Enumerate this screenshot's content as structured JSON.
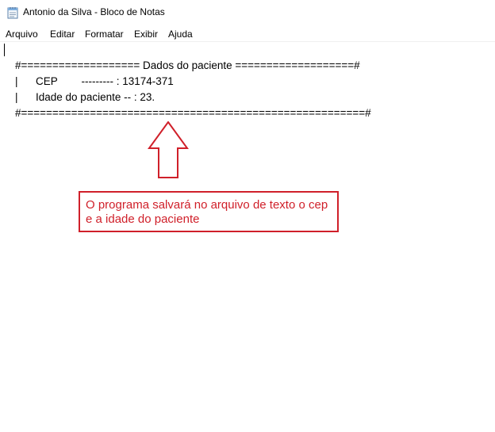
{
  "window": {
    "title": "Antonio da Silva - Bloco de Notas",
    "icon": "notepad-icon"
  },
  "menu": {
    "items": [
      "Arquivo",
      "Editar",
      "Formatar",
      "Exibir",
      "Ajuda"
    ]
  },
  "document": {
    "lines": [
      "#=================== Dados do paciente ===================#",
      "|      CEP        --------- : 13174-371",
      "|      Idade do paciente -- : 23.",
      "#=======================================================#"
    ]
  },
  "annotation": {
    "arrow": "up-arrow-icon",
    "color": "#d0202a",
    "text_line1": "O programa salvará no arquivo de texto o cep",
    "text_line2": "e a idade do paciente"
  }
}
